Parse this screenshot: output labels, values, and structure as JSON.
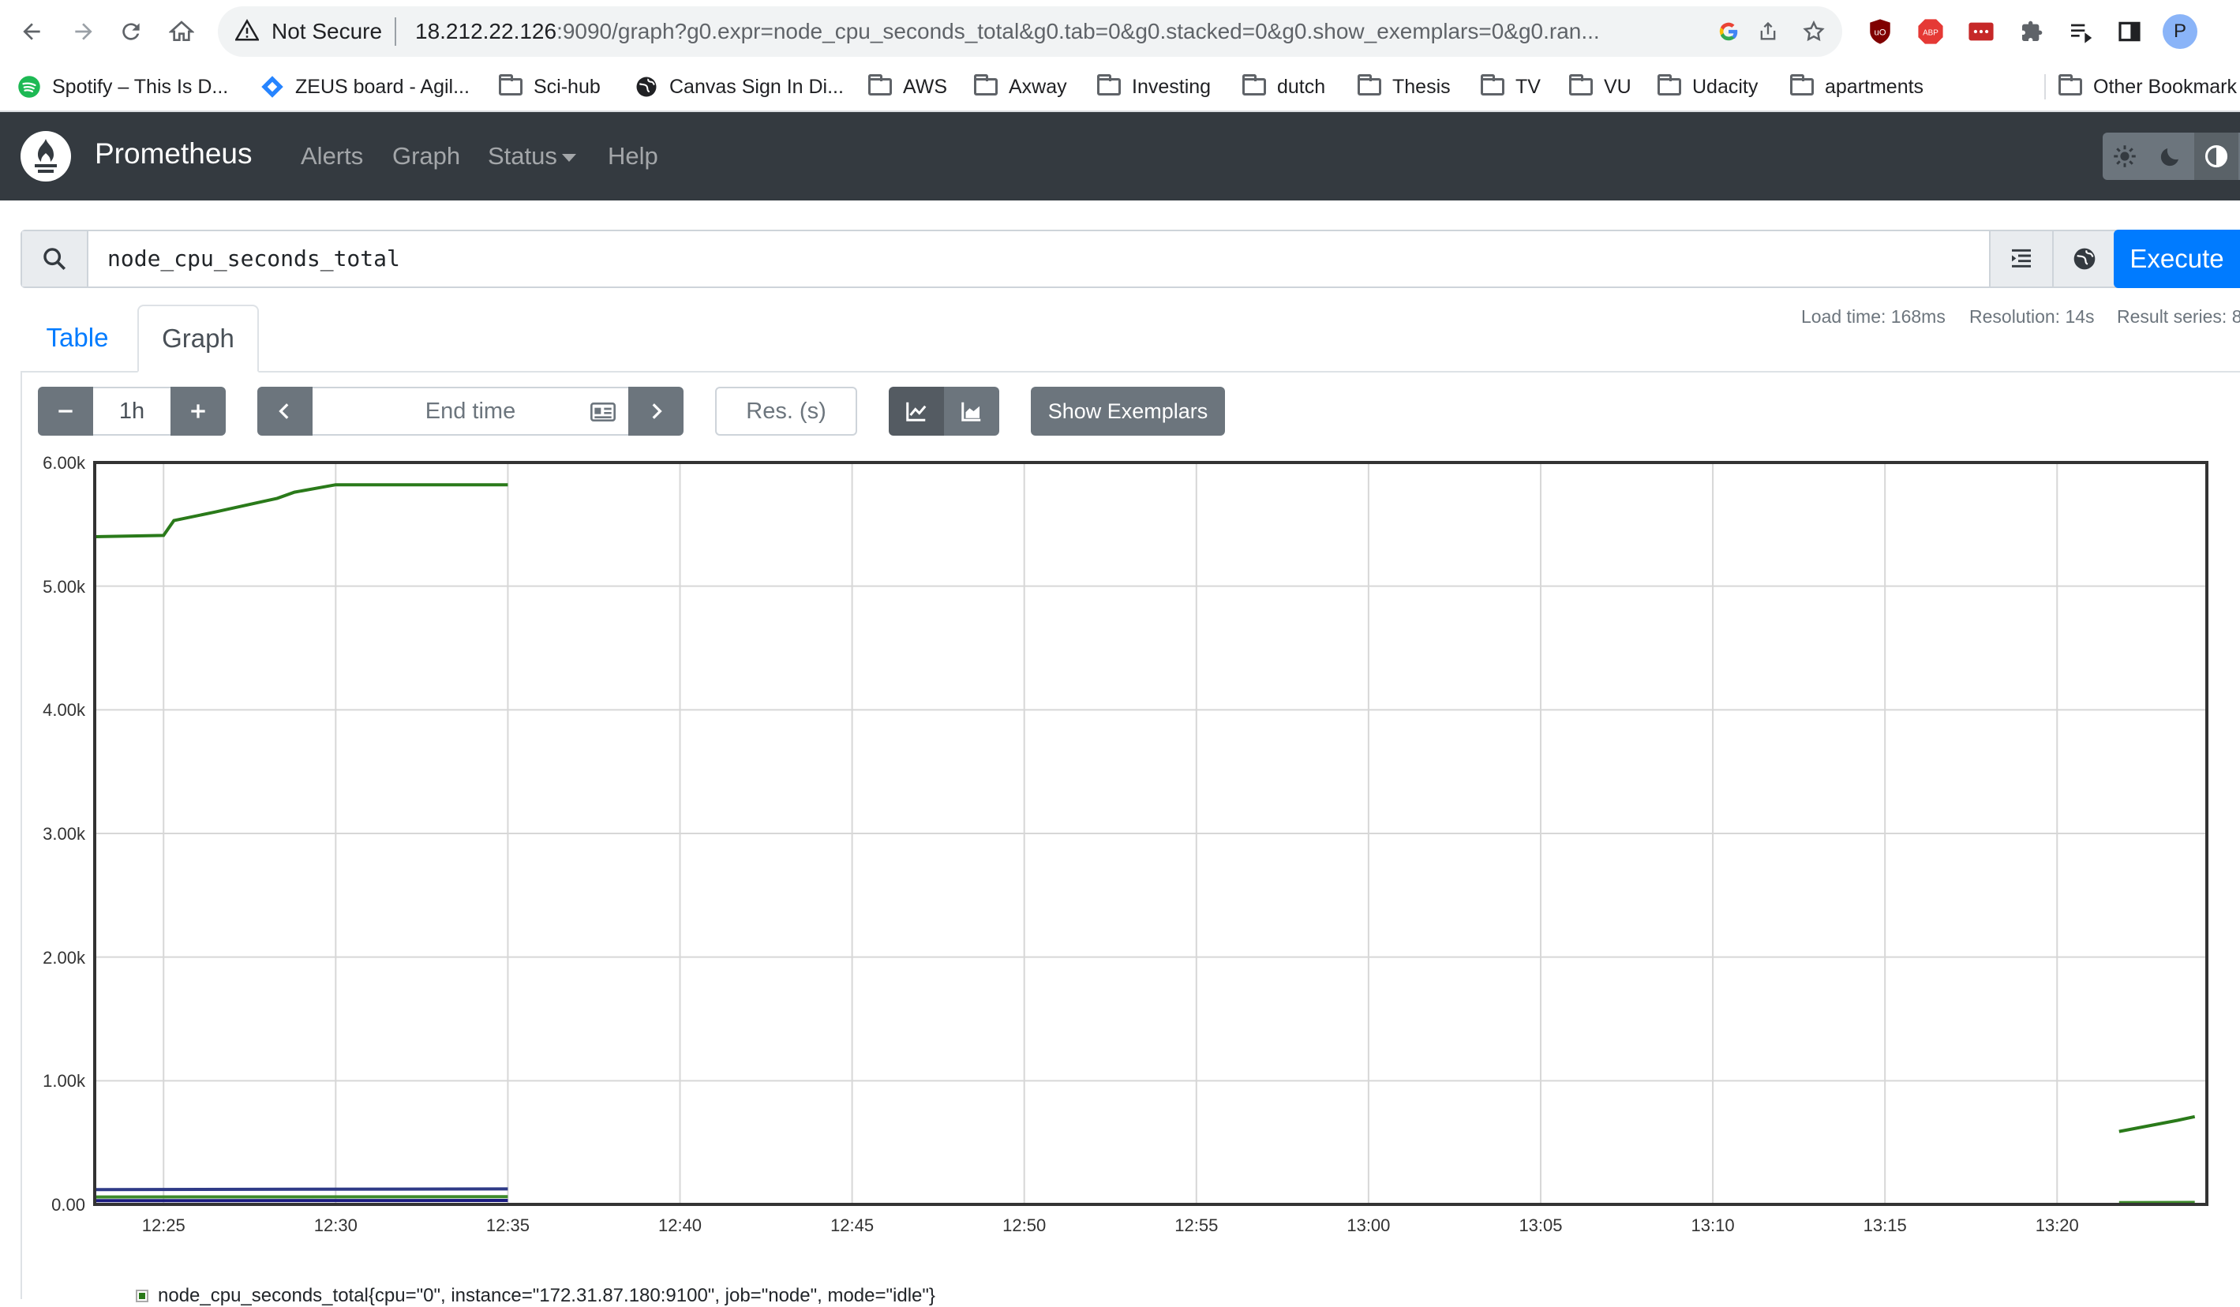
{
  "browser": {
    "security_label": "Not Secure",
    "url_host": "18.212.22.126",
    "url_rest": ":9090/graph?g0.expr=node_cpu_seconds_total&g0.tab=0&g0.stacked=0&g0.show_exemplars=0&g0.ran...",
    "profile_initial": "P",
    "extensions": [
      "ublock-icon",
      "adblock-plus-icon",
      "extension-red-icon",
      "puzzle-icon",
      "reading-list-icon",
      "side-panel-icon"
    ]
  },
  "bookmarks": {
    "items": [
      {
        "label": "Spotify – This Is D...",
        "icon": "spotify-icon"
      },
      {
        "label": "ZEUS board - Agil...",
        "icon": "jira-icon"
      },
      {
        "label": "Sci-hub",
        "icon": "folder-icon"
      },
      {
        "label": "Canvas Sign In Di...",
        "icon": "globe-icon"
      },
      {
        "label": "AWS",
        "icon": "folder-icon"
      },
      {
        "label": "Axway",
        "icon": "folder-icon"
      },
      {
        "label": "Investing",
        "icon": "folder-icon"
      },
      {
        "label": "dutch",
        "icon": "folder-icon"
      },
      {
        "label": "Thesis",
        "icon": "folder-icon"
      },
      {
        "label": "TV",
        "icon": "folder-icon"
      },
      {
        "label": "VU",
        "icon": "folder-icon"
      },
      {
        "label": "Udacity",
        "icon": "folder-icon"
      },
      {
        "label": "apartments",
        "icon": "folder-icon"
      }
    ],
    "other": "Other Bookmark"
  },
  "navbar": {
    "brand": "Prometheus",
    "links": [
      "Alerts",
      "Graph",
      "Status",
      "Help"
    ]
  },
  "query": {
    "expression": "node_cpu_seconds_total",
    "execute_label": "Execute"
  },
  "tabs": {
    "table": "Table",
    "graph": "Graph",
    "active": "Graph"
  },
  "stats": {
    "load_time": "Load time: 168ms",
    "resolution": "Resolution: 14s",
    "result_series": "Result series: 8"
  },
  "controls": {
    "range": "1h",
    "end_time_placeholder": "End time",
    "resolution_placeholder": "Res. (s)",
    "show_exemplars": "Show Exemplars"
  },
  "legend": {
    "entry": "node_cpu_seconds_total{cpu=\"0\", instance=\"172.31.87.180:9100\", job=\"node\", mode=\"idle\"}",
    "color": "#2a7a1a"
  },
  "chart_data": {
    "type": "line",
    "ylim": [
      0,
      6000
    ],
    "y_ticks": [
      "0.00",
      "1.00k",
      "2.00k",
      "3.00k",
      "4.00k",
      "5.00k",
      "6.00k"
    ],
    "x_ticks": [
      "12:25",
      "12:30",
      "12:35",
      "12:40",
      "12:45",
      "12:50",
      "12:55",
      "13:00",
      "13:05",
      "13:10",
      "13:15",
      "13:20"
    ],
    "grid": true,
    "series": [
      {
        "color": "#2a7a1a",
        "segments": [
          [
            [
              0,
              5400
            ],
            [
              2,
              5410
            ],
            [
              2.3,
              5530
            ],
            [
              3.5,
              5600
            ],
            [
              5.3,
              5710
            ],
            [
              5.8,
              5760
            ],
            [
              7,
              5820
            ],
            [
              12,
              5820
            ]
          ],
          [
            [
              58.8,
              590
            ],
            [
              60.5,
              680
            ],
            [
              61,
              710
            ]
          ]
        ]
      },
      {
        "color": "#2f3b87",
        "segments": [
          [
            [
              0,
              120
            ],
            [
              12,
              125
            ]
          ]
        ]
      },
      {
        "color": "#1a1a80",
        "segments": [
          [
            [
              0,
              30
            ],
            [
              12,
              32
            ]
          ]
        ]
      },
      {
        "color": "#3d8a2a",
        "segments": [
          [
            [
              0,
              60
            ],
            [
              12,
              62
            ]
          ],
          [
            [
              58.8,
              15
            ],
            [
              61,
              16
            ]
          ]
        ]
      }
    ]
  },
  "colors": {
    "navbar": "#343a40",
    "execute": "#007bff",
    "button_gray": "#6c757d",
    "tab_link": "#007bff"
  }
}
